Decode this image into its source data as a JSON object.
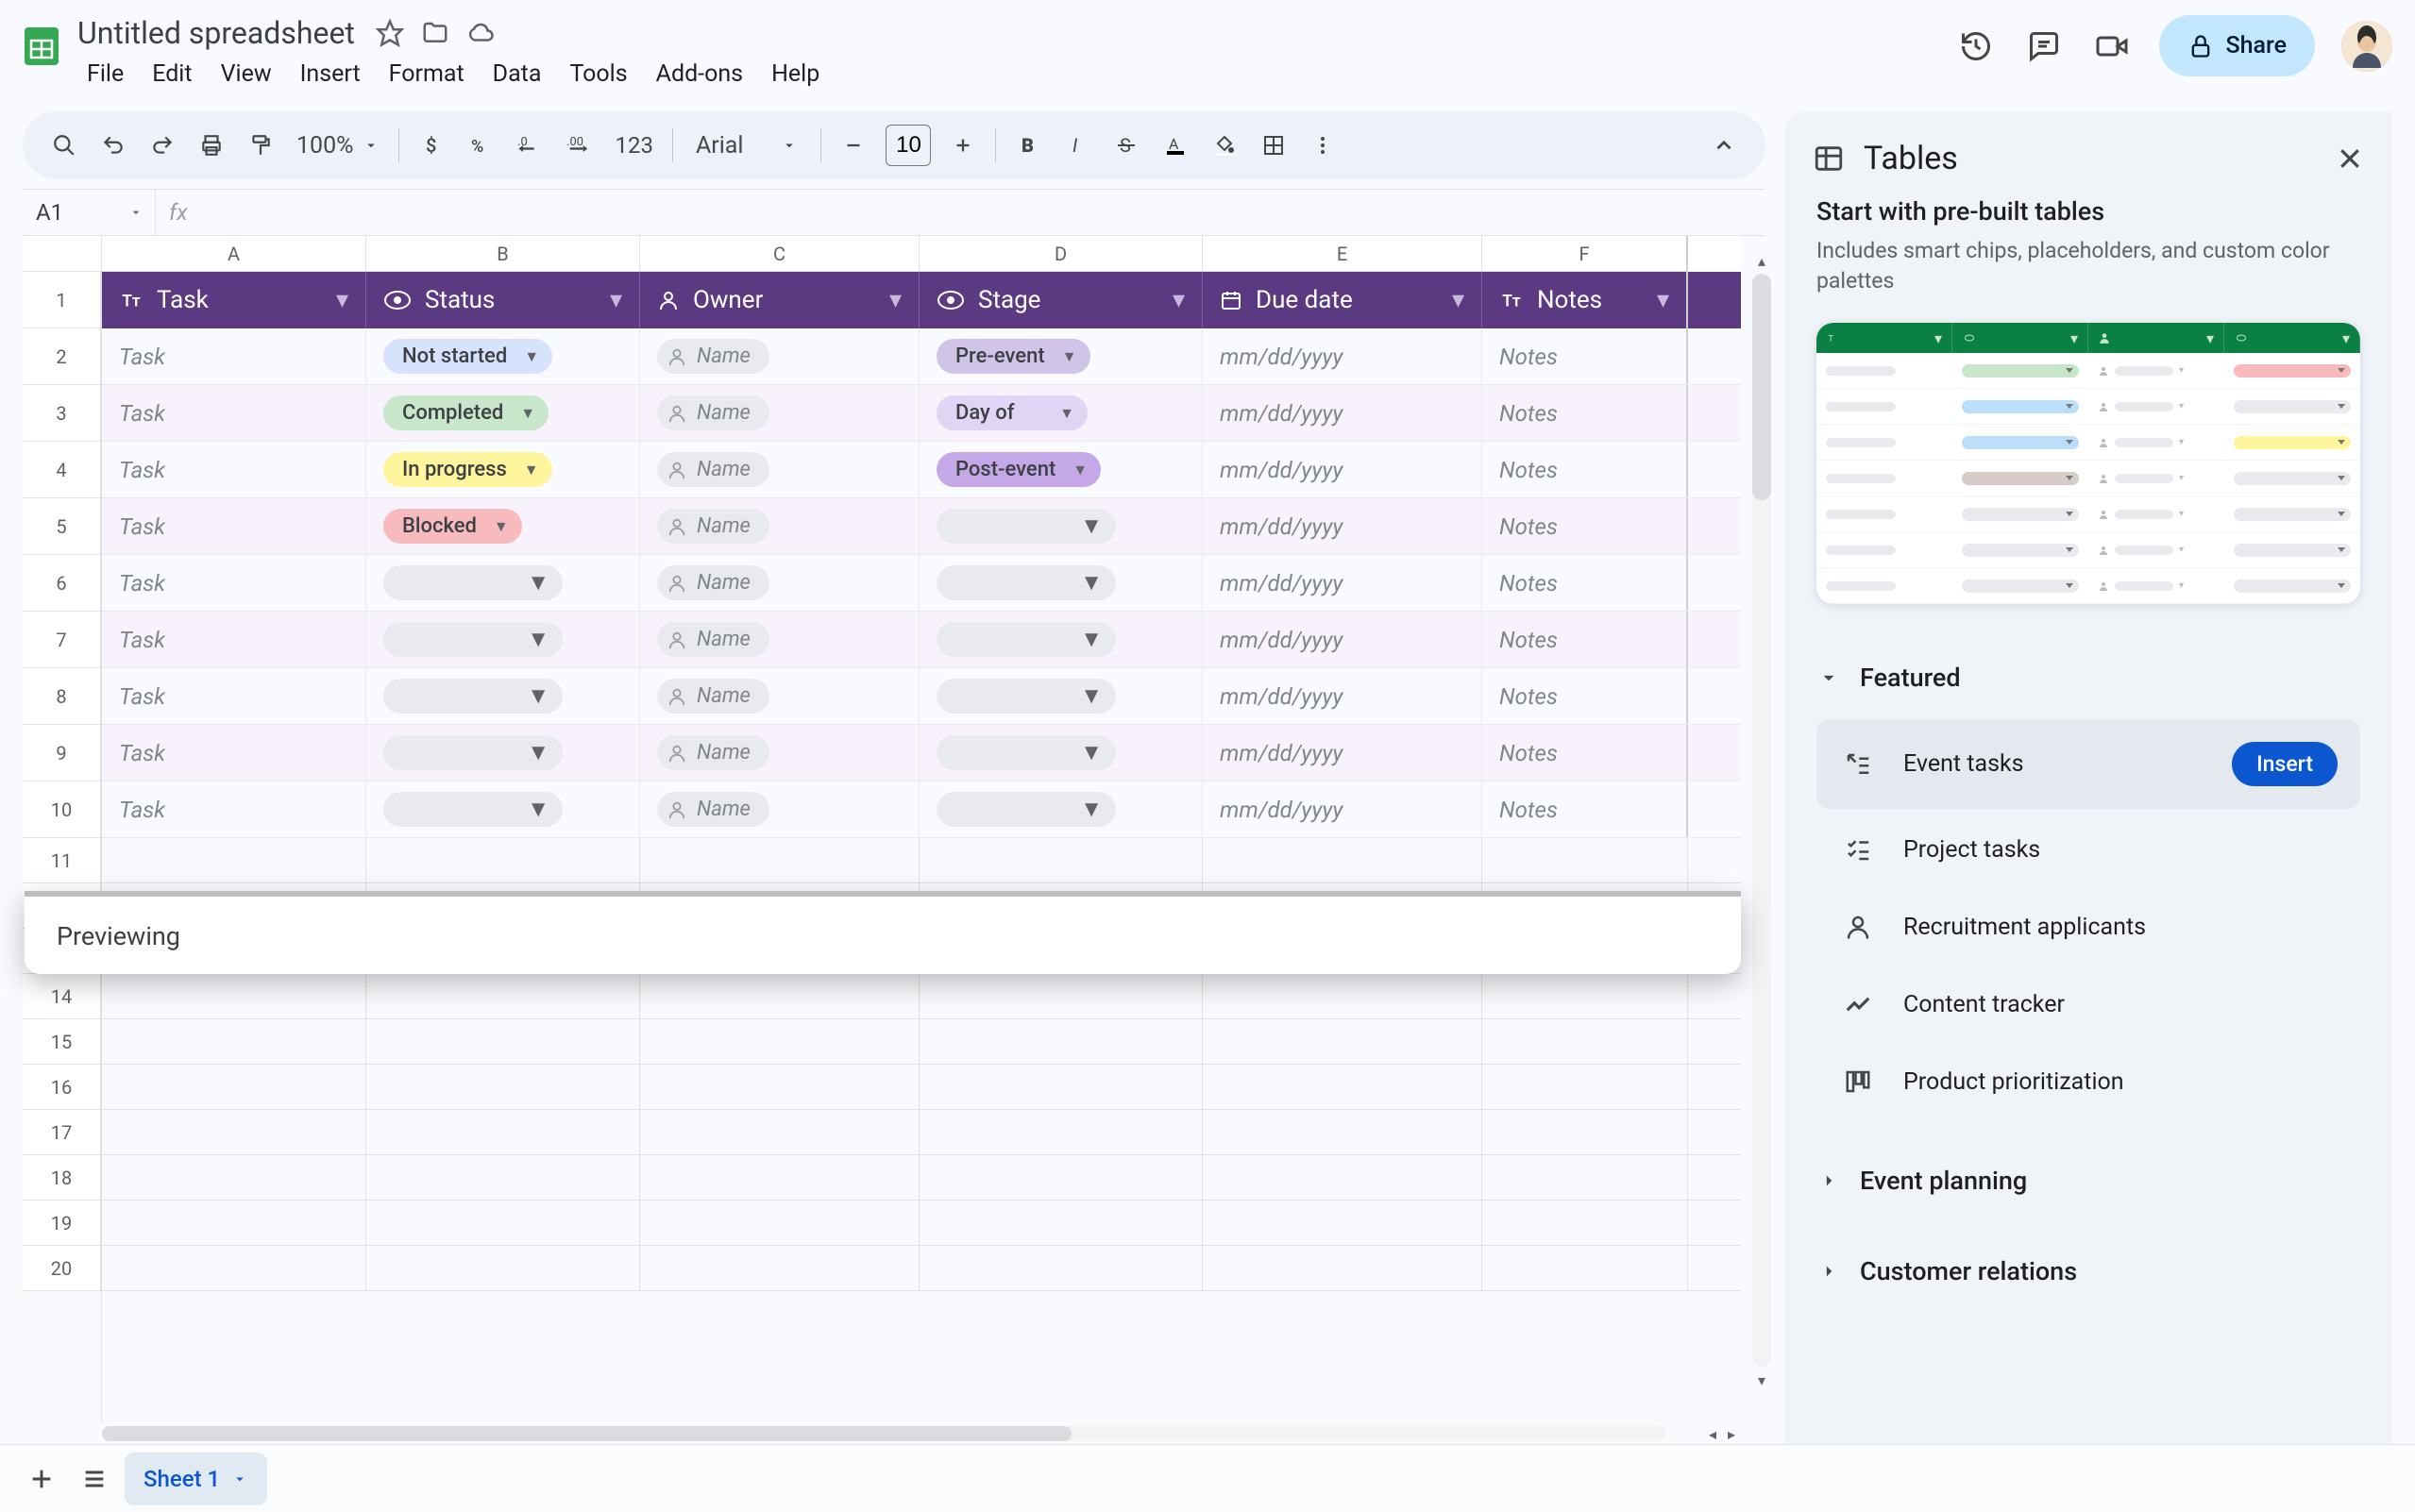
{
  "doc": {
    "title": "Untitled spreadsheet"
  },
  "menus": [
    "File",
    "Edit",
    "View",
    "Insert",
    "Format",
    "Data",
    "Tools",
    "Add-ons",
    "Help"
  ],
  "share_label": "Share",
  "toolbar": {
    "zoom": "100%",
    "font": "Arial",
    "font_size": "10",
    "number_format": "123"
  },
  "namebox": "A1",
  "columns": [
    "A",
    "B",
    "C",
    "D",
    "E",
    "F"
  ],
  "table_headers": {
    "task": "Task",
    "status": "Status",
    "owner": "Owner",
    "stage": "Stage",
    "due": "Due date",
    "notes": "Notes"
  },
  "placeholders": {
    "task": "Task",
    "owner": "Name",
    "due": "mm/dd/yyyy",
    "notes": "Notes"
  },
  "status_labels": {
    "not_started": "Not started",
    "completed": "Completed",
    "in_progress": "In progress",
    "blocked": "Blocked"
  },
  "stage_labels": {
    "pre": "Pre-event",
    "day": "Day of",
    "post": "Post-event"
  },
  "rows": [
    {
      "status": "not_started",
      "stage": "pre"
    },
    {
      "status": "completed",
      "stage": "day"
    },
    {
      "status": "in_progress",
      "stage": "post"
    },
    {
      "status": "blocked",
      "stage": ""
    },
    {
      "status": "",
      "stage": ""
    },
    {
      "status": "",
      "stage": ""
    },
    {
      "status": "",
      "stage": ""
    },
    {
      "status": "",
      "stage": ""
    },
    {
      "status": "",
      "stage": ""
    }
  ],
  "preview_label": "Previewing",
  "sheet_tab": "Sheet 1",
  "sidebar": {
    "title": "Tables",
    "subtitle": "Start with pre-built tables",
    "desc": "Includes smart chips, placeholders, and custom color palettes",
    "sections": {
      "featured": {
        "label": "Featured",
        "items": [
          "Event tasks",
          "Project tasks",
          "Recruitment applicants",
          "Content tracker",
          "Product prioritization"
        ]
      },
      "event_planning": {
        "label": "Event planning"
      },
      "customer_relations": {
        "label": "Customer relations"
      }
    },
    "insert_label": "Insert"
  }
}
